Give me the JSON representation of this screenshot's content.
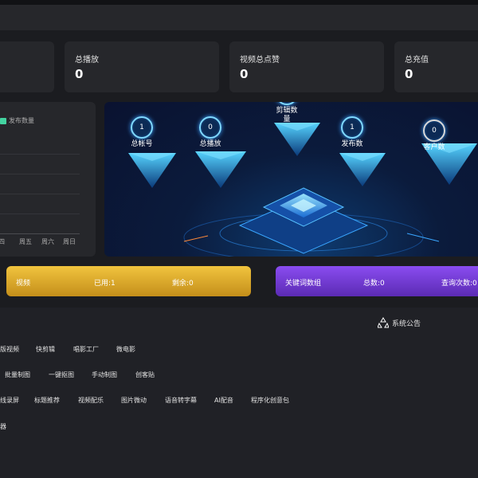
{
  "stats": [
    {
      "label": "总播放",
      "value": "0"
    },
    {
      "label": "视频总点赞",
      "value": "0"
    },
    {
      "label": "总充值",
      "value": "0"
    }
  ],
  "chart_data": {
    "type": "bar",
    "categories": [
      "周四",
      "周五",
      "周六",
      "周日"
    ],
    "series": [
      {
        "name": "发布数量",
        "values": [
          0,
          0,
          0,
          0
        ]
      }
    ],
    "title": "",
    "xlabel": "",
    "ylabel": ""
  },
  "nodes": [
    {
      "value": "1",
      "label": "总帐号"
    },
    {
      "value": "0",
      "label": "总播放"
    },
    {
      "value": "0",
      "label": "剪辑数量"
    },
    {
      "value": "1",
      "label": "发布数"
    },
    {
      "value": "0",
      "label": "客户数"
    }
  ],
  "video_band": {
    "title": "视频",
    "used": "已用:1",
    "remain": "剩余:0",
    "color": "#e9b62f"
  },
  "keyword_band": {
    "title": "关键词数组",
    "total": "总数:0",
    "query": "查询次数:0",
    "color": "#7b3fe0"
  },
  "notice": {
    "label": "系统公告",
    "icon": "recycle-icon"
  },
  "tools": {
    "row1": [
      "版视频",
      "快剪辑",
      "唱影工厂",
      "微电影"
    ],
    "row2": [
      "批量制图",
      "一键抠图",
      "手动制图",
      "创客贴"
    ],
    "row3": [
      "线录屏",
      "标题推荐",
      "视频配乐",
      "图片微动",
      "语音转字幕",
      "AI配音",
      "程序化创意包"
    ],
    "row4": [
      "器"
    ]
  }
}
